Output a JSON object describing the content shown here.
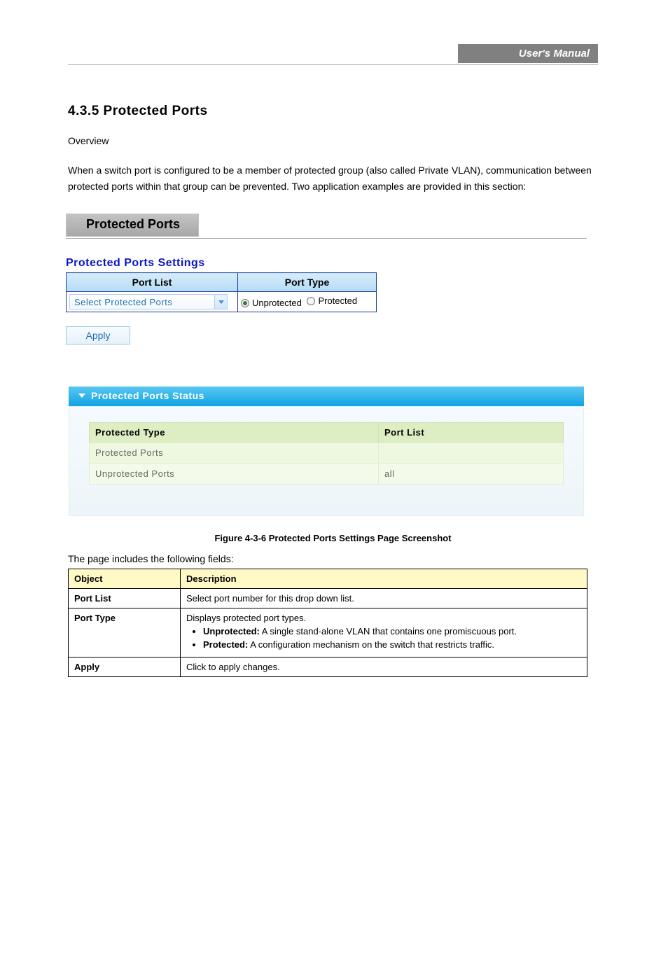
{
  "header": {
    "right_label": "User's Manual"
  },
  "section": {
    "number": "4.3.5",
    "title": "Protected Ports",
    "description_1": "Overview",
    "description_2": "When a switch port is configured to be a member of protected group (also called Private VLAN), communication between protected ports within that group can be prevented. Two application examples are provided in this section:"
  },
  "ui": {
    "panel_title": "Protected Ports",
    "settings_title": "Protected Ports Settings",
    "table_headers": {
      "port_list": "Port List",
      "port_type": "Port Type"
    },
    "dropdown_text": "Select Protected Ports",
    "radio": {
      "unprotected": "Unprotected",
      "protected": "Protected"
    },
    "apply": "Apply",
    "status_header": "Protected Ports Status",
    "status_columns": {
      "type": "Protected Type",
      "list": "Port List"
    },
    "status_rows": [
      {
        "type": "Protected Ports",
        "list": ""
      },
      {
        "type": "Unprotected Ports",
        "list": "all"
      }
    ]
  },
  "caption": "Figure 4-3-6 Protected Ports Settings Page Screenshot",
  "obj_intro": "The page includes the following fields:",
  "obj_table": {
    "h1": "Object",
    "h2": "Description",
    "rows": [
      {
        "obj": "Port List",
        "desc": "Select port number for this drop down list."
      },
      {
        "obj": "Port Type",
        "desc_intro": "Displays protected port types.",
        "bullets": [
          {
            "b": "Unprotected:",
            "t": " A single stand-alone VLAN that contains one promiscuous port."
          },
          {
            "b": "Protected:",
            "t": " A configuration mechanism on the switch that restricts traffic."
          }
        ]
      },
      {
        "obj": "Apply",
        "desc": "Click to apply changes."
      }
    ]
  },
  "footer": {
    "left": "",
    "right": ""
  }
}
